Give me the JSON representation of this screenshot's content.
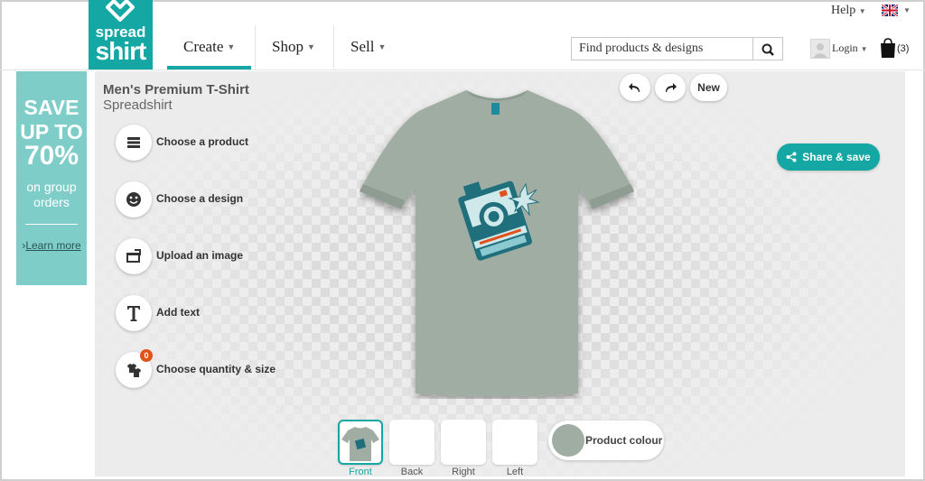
{
  "brand": {
    "line1": "spread",
    "line2": "shirt"
  },
  "header": {
    "help_label": "Help",
    "nav": [
      {
        "label": "Create"
      },
      {
        "label": "Shop"
      },
      {
        "label": "Sell"
      }
    ],
    "search_placeholder": "Find products & designs",
    "login_label": "Login",
    "cart_count": "(3)"
  },
  "promo": {
    "line1": "SAVE",
    "line2": "UP TO",
    "line3": "70%",
    "line4": "on group",
    "line5": "orders",
    "link": "Learn more"
  },
  "product": {
    "title": "Men's Premium T-Shirt",
    "brand": "Spreadshirt",
    "shirt_color": "#a0ada3"
  },
  "steps": [
    {
      "label": "Choose a product"
    },
    {
      "label": "Choose a design"
    },
    {
      "label": "Upload an image"
    },
    {
      "label": "Add text"
    },
    {
      "label": "Choose quantity & size",
      "badge": "0"
    }
  ],
  "toolbar": {
    "new_label": "New",
    "share_label": "Share & save"
  },
  "views": [
    {
      "label": "Front"
    },
    {
      "label": "Back"
    },
    {
      "label": "Right"
    },
    {
      "label": "Left"
    }
  ],
  "colour_label": "Product colour",
  "colors": {
    "accent": "#14a7a3",
    "promo": "#7fcdc9",
    "badge": "#e2501b"
  }
}
